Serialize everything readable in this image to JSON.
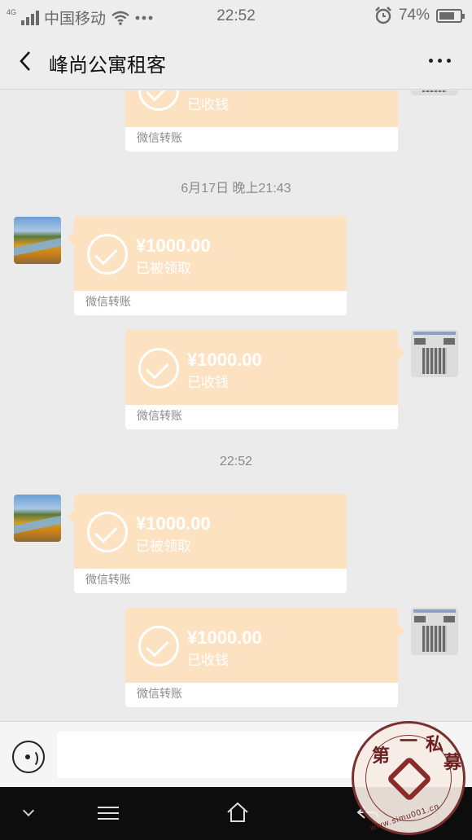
{
  "status_bar": {
    "network_type": "4G",
    "carrier": "中国移动",
    "time": "22:52",
    "battery_percent": "74%",
    "battery_level": 0.74,
    "icons": [
      "signal-icon",
      "wifi-icon",
      "more-dots-icon",
      "alarm-icon",
      "battery-icon"
    ]
  },
  "header": {
    "title": "峰尚公寓租客",
    "back_icon": "chevron-left-icon",
    "more_icon": "more-horizontal-icon"
  },
  "chat": {
    "transfer_label": "微信转账",
    "messages": [
      {
        "side": "right",
        "type": "transfer",
        "amount": "",
        "status": "已收钱",
        "footer": "微信转账"
      },
      {
        "type": "timestamp",
        "text": "6月17日 晚上21:43"
      },
      {
        "side": "left",
        "type": "transfer",
        "amount": "¥1000.00",
        "status": "已被领取",
        "footer": "微信转账"
      },
      {
        "side": "right",
        "type": "transfer",
        "amount": "¥1000.00",
        "status": "已收钱",
        "footer": "微信转账"
      },
      {
        "type": "timestamp",
        "text": "22:52"
      },
      {
        "side": "left",
        "type": "transfer",
        "amount": "¥1000.00",
        "status": "已被领取",
        "footer": "微信转账"
      },
      {
        "side": "right",
        "type": "transfer",
        "amount": "¥1000.00",
        "status": "已收钱",
        "footer": "微信转账"
      }
    ]
  },
  "input_bar": {
    "voice_icon": "voice-input-icon",
    "text_value": ""
  },
  "nav_bar": {
    "icons": [
      "collapse-down-icon",
      "menu-icon",
      "home-icon",
      "back-arrow-icon"
    ]
  },
  "watermark": {
    "chars": [
      "第",
      "一",
      "私",
      "募"
    ],
    "url": "www.simu001.cn"
  },
  "colors": {
    "transfer_bubble": "#fde2c2",
    "background": "#ebebeb",
    "header_bg": "#ededed",
    "nav_bg": "#0d0d0d"
  }
}
